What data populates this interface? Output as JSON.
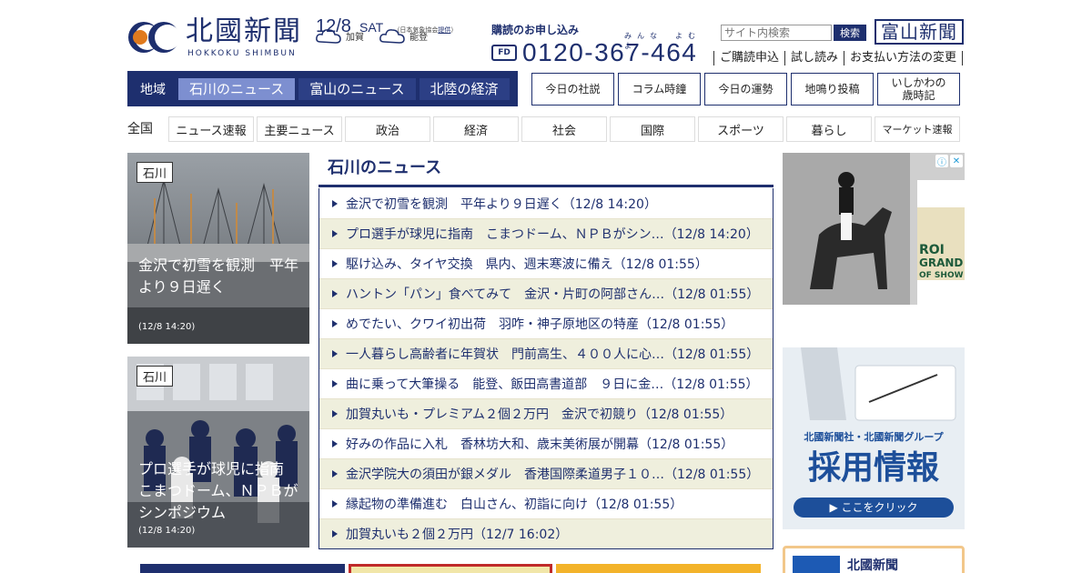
{
  "brand": {
    "name": "北國新聞",
    "roman": "HOKKOKU SHIMBUN",
    "toyama_logo": "富山新聞"
  },
  "date": {
    "date": "12/8",
    "day": "SAT",
    "source_pre": "（日本気象協会",
    "source_link": "提供",
    "source_post": "）"
  },
  "weather": [
    {
      "area": "加賀",
      "icon": "cloud-icon"
    },
    {
      "area": "能登",
      "icon": "cloud-icon"
    }
  ],
  "subscribe": {
    "label": "購読のお申し込み",
    "ruby": "みんな　よむよ",
    "freedial": "FD",
    "phone": "0120-367-464"
  },
  "search": {
    "placeholder": "サイト内検索",
    "button": "検索"
  },
  "util_links": [
    "ご購読申込",
    "試し読み",
    "お支払い方法の変更"
  ],
  "region_nav": {
    "label": "地域",
    "tabs": [
      "石川のニュース",
      "富山のニュース",
      "北陸の経済"
    ]
  },
  "box_links": [
    "今日の社説",
    "コラム時鐘",
    "今日の運勢",
    "地鳴り投稿",
    "いしかわの\n歳時記"
  ],
  "category_nav": {
    "label": "全国",
    "items": [
      "ニュース速報",
      "主要ニュース",
      "政治",
      "経済",
      "社会",
      "国際",
      "スポーツ",
      "暮らし",
      "マーケット速報"
    ]
  },
  "photo_cards": [
    {
      "tag": "石川",
      "caption": "金沢で初雪を観測　平年より９日遅く",
      "time": "(12/8 14:20)"
    },
    {
      "tag": "石川",
      "caption": "プロ選手が球児に指南　こまつドーム、ＮＰＢがシンポジウム",
      "time": "(12/8 14:20)"
    }
  ],
  "news": {
    "title": "石川のニュース",
    "items": [
      "金沢で初雪を観測　平年より９日遅く（12/8 14:20）",
      "プロ選手が球児に指南　こまつドーム、ＮＰＢがシン…（12/8 14:20）",
      "駆け込み、タイヤ交換　県内、週末寒波に備え（12/8 01:55）",
      "ハントン「パン」食べてみて　金沢・片町の阿部さん…（12/8 01:55）",
      "めでたい、クワイ初出荷　羽咋・神子原地区の特産（12/8 01:55）",
      "一人暮らし高齢者に年賀状　門前高生、４００人に心…（12/8 01:55）",
      "曲に乗って大筆操る　能登、飯田高書道部　９日に金…（12/8 01:55）",
      "加賀丸いも・プレミアム２個２万円　金沢で初競り（12/8 01:55）",
      "好みの作品に入札　香林坊大和、歳末美術展が開幕（12/8 01:55）",
      "金沢学院大の須田が銀メダル　香港国際柔道男子１０…（12/8 01:55）",
      "縁起物の準備進む　白山さん、初詣に向け（12/8 01:55）",
      "加賀丸いも２個２万円（12/7 16:02）"
    ]
  },
  "ads": {
    "ad1": {
      "text": "ROLEX GRAND SLAM OF SHOW JUMPING",
      "lines": [
        "ROI",
        "GRAND",
        "OF SHOW"
      ]
    },
    "ad2": {
      "group": "北國新聞社・北國新聞グループ",
      "title": "採用情報",
      "cta": "▶ ここをクリック"
    },
    "ad3": {
      "title": "北國新聞"
    }
  },
  "colors": {
    "navy": "#1e2f6e",
    "active_tab": "#7d8fd0",
    "stripe": "#efefdd"
  }
}
